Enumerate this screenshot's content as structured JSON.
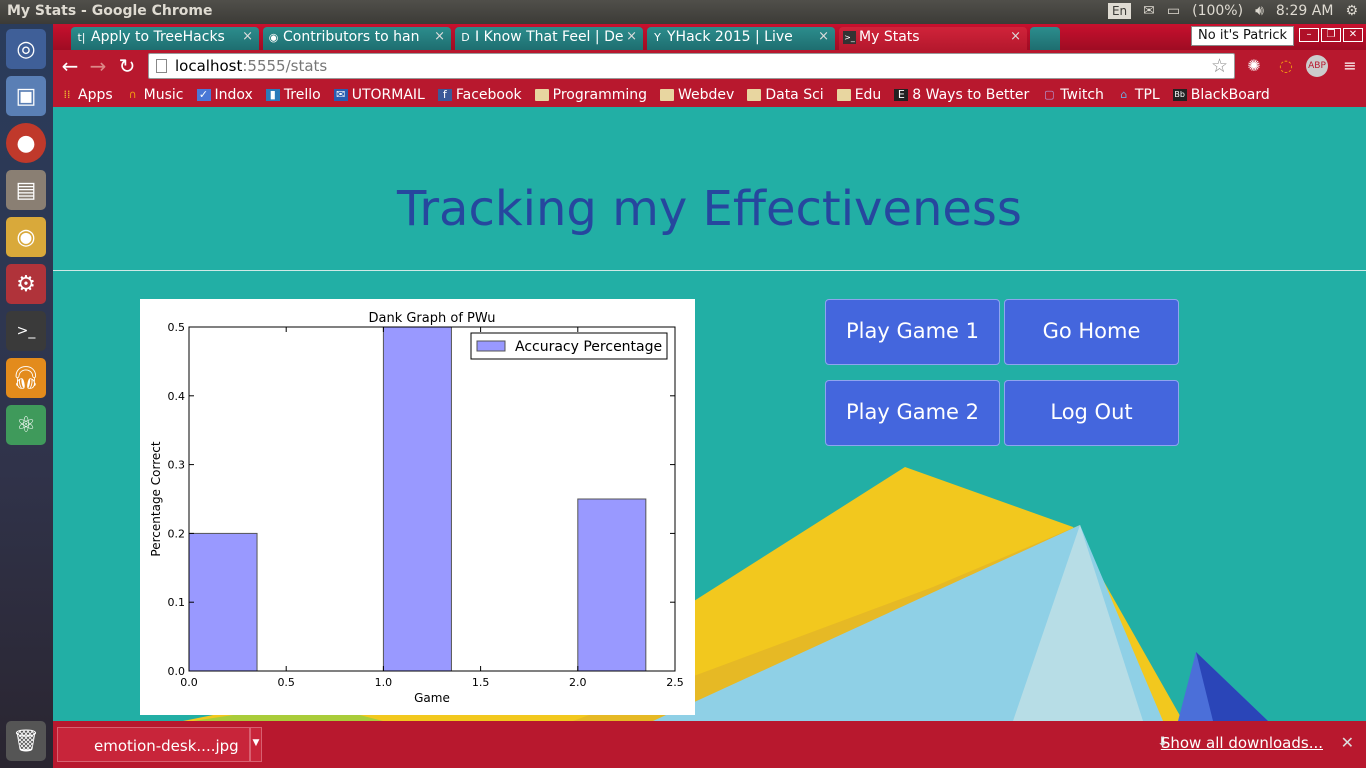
{
  "os_panel": {
    "window_title": "My Stats - Google Chrome",
    "keyboard": "En",
    "battery": "(100%)",
    "clock": "8:29 AM"
  },
  "tabs": [
    {
      "label": "Apply to TreeHacks",
      "favicon": "t|"
    },
    {
      "label": "Contributors to han",
      "favicon": "◉"
    },
    {
      "label": "I Know That Feel | De",
      "favicon": "D"
    },
    {
      "label": "YHack 2015 | Live",
      "favicon": "Y"
    },
    {
      "label": "My Stats",
      "favicon": ">_"
    }
  ],
  "profile": "No it's Patrick",
  "address": {
    "host": "localhost",
    "path": ":5555/stats"
  },
  "bookmarks": [
    {
      "label": "Apps",
      "icon": "apps-grid-icon"
    },
    {
      "label": "Music",
      "icon": "headphones-icon"
    },
    {
      "label": "Indox",
      "icon": "inbox-icon"
    },
    {
      "label": "Trello",
      "icon": "trello-icon"
    },
    {
      "label": "UTORMAIL",
      "icon": "mail-icon"
    },
    {
      "label": "Facebook",
      "icon": "facebook-icon"
    },
    {
      "label": "Programming",
      "icon": "folder-icon"
    },
    {
      "label": "Webdev",
      "icon": "folder-icon"
    },
    {
      "label": "Data Sci",
      "icon": "folder-icon"
    },
    {
      "label": "Edu",
      "icon": "folder-icon"
    },
    {
      "label": "8 Ways to Better",
      "icon": "e-icon"
    },
    {
      "label": "Twitch",
      "icon": "twitch-icon"
    },
    {
      "label": "TPL",
      "icon": "tpl-icon"
    },
    {
      "label": "BlackBoard",
      "icon": "blackboard-icon"
    }
  ],
  "page": {
    "title": "Tracking my Effectiveness",
    "buttons": {
      "game1": "Play Game 1",
      "home": "Go Home",
      "game2": "Play Game 2",
      "logout": "Log Out"
    }
  },
  "chart_data": {
    "type": "bar",
    "title": "Dank Graph of PWu",
    "xlabel": "Game",
    "ylabel": "Percentage Correct",
    "x": [
      0,
      1,
      2
    ],
    "bar_width": 0.35,
    "values": [
      0.2,
      0.5,
      0.25
    ],
    "series": [
      {
        "name": "Accuracy Percentage",
        "values": [
          0.2,
          0.5,
          0.25
        ]
      }
    ],
    "xlim": [
      0.0,
      2.5
    ],
    "ylim": [
      0.0,
      0.5
    ],
    "xticks": [
      "0.0",
      "0.5",
      "1.0",
      "1.5",
      "2.0",
      "2.5"
    ],
    "yticks": [
      "0.0",
      "0.1",
      "0.2",
      "0.3",
      "0.4",
      "0.5"
    ],
    "legend": "top-right",
    "bar_color": "#9999ff",
    "grid": false
  },
  "downloads": {
    "file": "emotion-desk....jpg",
    "show_all": "Show all downloads..."
  },
  "colors": {
    "page_bg": "#22afa5",
    "title": "#26479e",
    "button": "#4466dd",
    "chrome_theme": "#b8182e"
  }
}
